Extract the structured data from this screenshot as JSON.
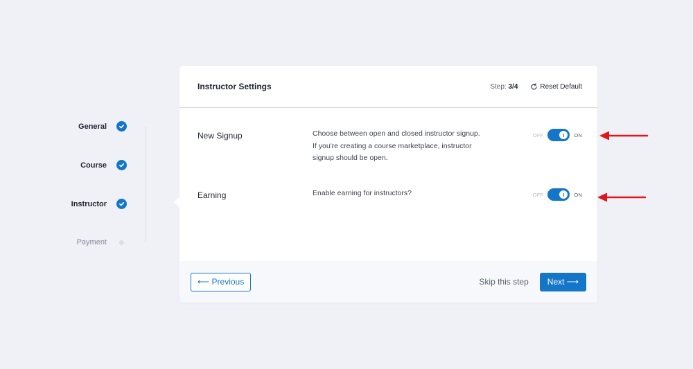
{
  "stepper": {
    "steps": [
      {
        "label": "General",
        "status": "complete"
      },
      {
        "label": "Course",
        "status": "complete"
      },
      {
        "label": "Instructor",
        "status": "complete"
      },
      {
        "label": "Payment",
        "status": "pending"
      }
    ]
  },
  "card": {
    "title": "Instructor Settings",
    "step_prefix": "Step: ",
    "step_value": "3/4",
    "reset_label": "Reset Default"
  },
  "settings": [
    {
      "name": "New Signup",
      "description": "Choose between open and closed instructor signup. If you're creating a course marketplace, instructor signup should be open.",
      "off_label": "OFF",
      "on_label": "ON",
      "enabled": true
    },
    {
      "name": "Earning",
      "description": "Enable earning for instructors?",
      "off_label": "OFF",
      "on_label": "ON",
      "enabled": true
    }
  ],
  "footer": {
    "previous_label": "⟵ Previous",
    "skip_label": "Skip this step",
    "next_label": "Next ⟶"
  },
  "colors": {
    "accent": "#1376c8",
    "background": "#f0f1f7",
    "annotation_arrow": "#e3141a"
  }
}
